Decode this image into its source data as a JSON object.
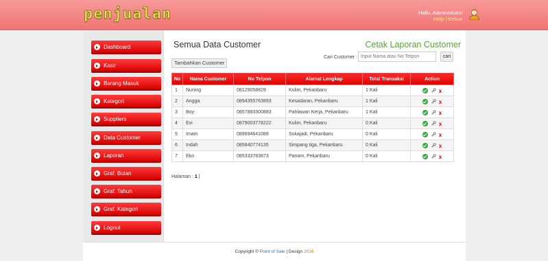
{
  "header": {
    "logo": "penjualan",
    "greeting": "Hallo, Administrator",
    "links": "Help | Keluar"
  },
  "sidebar": {
    "items": [
      {
        "label": "Dashboard"
      },
      {
        "label": "Kasir"
      },
      {
        "label": "Barang Masuk"
      },
      {
        "label": "Kategori"
      },
      {
        "label": "Suppliers"
      },
      {
        "label": "Data Customer"
      },
      {
        "label": "Laporan"
      },
      {
        "label": "Graf. Bulan"
      },
      {
        "label": "Graf. Tahun"
      },
      {
        "label": "Graf. Kategori"
      },
      {
        "label": "Logout"
      }
    ]
  },
  "main": {
    "title": "Semua Data Customer",
    "print_link": "Cetak Laporan Customer",
    "search_label": "Cari Customer :",
    "search_placeholder": "Input Nama atau No Telpon",
    "search_button": "cari",
    "add_button": "Tambahkan Customer",
    "columns": [
      "No",
      "Nama Customer",
      "No Telpon",
      "Alamat Lengkap",
      "Total Transaksi",
      "Action"
    ],
    "rows": [
      {
        "no": "1",
        "nama": "Nuning",
        "telpon": "08129058829",
        "alamat": "Kulim, Pekanbaru",
        "transaksi": "1 Kali"
      },
      {
        "no": "2",
        "nama": "Angga",
        "telpon": "0894355763893",
        "alamat": "Kesadaran, Pekanbaru",
        "transaksi": "1 Kali"
      },
      {
        "no": "3",
        "nama": "Boy",
        "telpon": "0857883300883",
        "alamat": "Pahlawan Kerja, Pekanbaru",
        "transaksi": "1 Kali"
      },
      {
        "no": "4",
        "nama": "Evi",
        "telpon": "0879003778222",
        "alamat": "Kulim, Pekanbaru",
        "transaksi": "0 Kali"
      },
      {
        "no": "5",
        "nama": "Imam",
        "telpon": "089694641088",
        "alamat": "Sukajadi, Pekanbaru",
        "transaksi": "0 Kali"
      },
      {
        "no": "6",
        "nama": "Indah",
        "telpon": "085840774135",
        "alamat": "Simpang tiga, Pekanbaru",
        "transaksi": "0 Kali"
      },
      {
        "no": "7",
        "nama": "Eko",
        "telpon": "085333783873",
        "alamat": "Panam, Pekanbaru",
        "transaksi": "0 Kali"
      }
    ],
    "pager_label": "Halaman :",
    "pager_current": "1",
    "pager_sep": "|"
  },
  "footer": {
    "prefix": "Copyright ©",
    "app": "Point of Sale",
    "sep": "| Design",
    "year": "2016"
  },
  "colors": {
    "header": "#f07474",
    "accent_red": "#dd0000",
    "link_green": "#5aa33a"
  }
}
